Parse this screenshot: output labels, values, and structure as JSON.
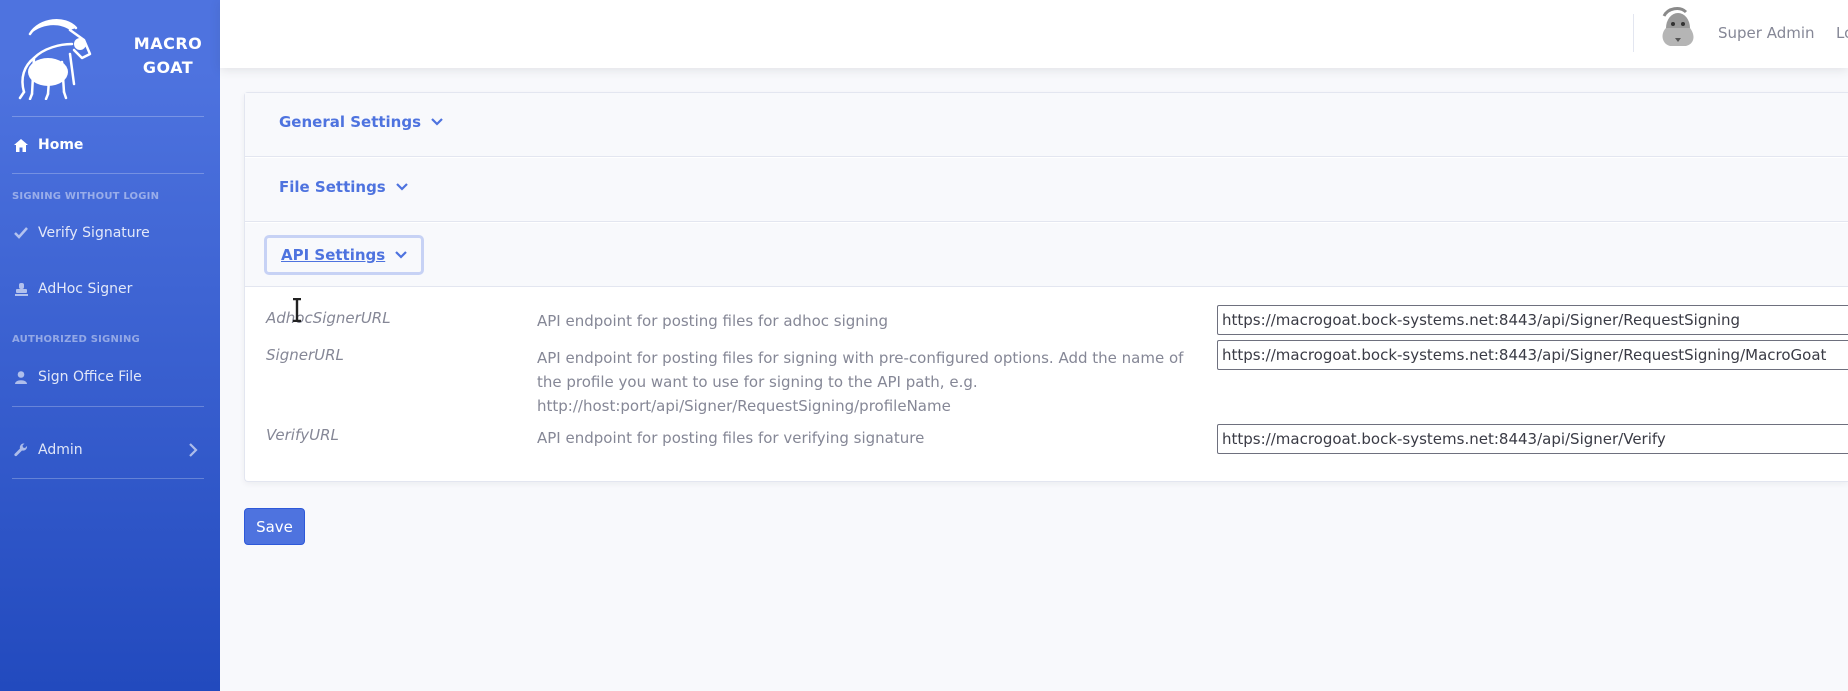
{
  "app": {
    "brand": "MACRO GOAT"
  },
  "sidebar": {
    "home": "Home",
    "heading_signing_without_login": "SIGNING WITHOUT LOGIN",
    "verify_signature": "Verify Signature",
    "adhoc_signer": "AdHoc Signer",
    "heading_authorized_signing": "AUTHORIZED SIGNING",
    "sign_office_file": "Sign Office File",
    "admin": "Admin"
  },
  "topbar": {
    "user_name": "Super Admin",
    "trailing_text": "Lo"
  },
  "accordion": {
    "sections": [
      {
        "label": "General Settings",
        "expanded": false
      },
      {
        "label": "File Settings",
        "expanded": false
      },
      {
        "label": "API Settings",
        "expanded": true
      }
    ]
  },
  "api_settings": {
    "rows": [
      {
        "name": "AdhocSignerURL",
        "description": "API endpoint for posting files for adhoc signing",
        "value": "https://macrogoat.bock-systems.net:8443/api/Signer/RequestSigning"
      },
      {
        "name": "SignerURL",
        "description": "API endpoint for posting files for signing with pre-configured options. Add the name of the profile you want to use for signing to the API path, e.g. http://host:port/api/Signer/RequestSigning/profileName",
        "value": "https://macrogoat.bock-systems.net:8443/api/Signer/RequestSigning/MacroGoat"
      },
      {
        "name": "VerifyURL",
        "description": "API endpoint for posting files for verifying signature",
        "value": "https://macrogoat.bock-systems.net:8443/api/Signer/Verify"
      }
    ]
  },
  "actions": {
    "save_label": "Save"
  },
  "icons": {
    "home": "home-icon",
    "verify": "check-icon",
    "adhoc": "stamp-icon",
    "sign_office": "user-icon",
    "admin": "wrench-icon",
    "chevron": "chevron-down-icon"
  },
  "colors": {
    "primary": "#4e73df",
    "sidebar_gradient_end": "#224abe",
    "text_muted": "#858796"
  }
}
